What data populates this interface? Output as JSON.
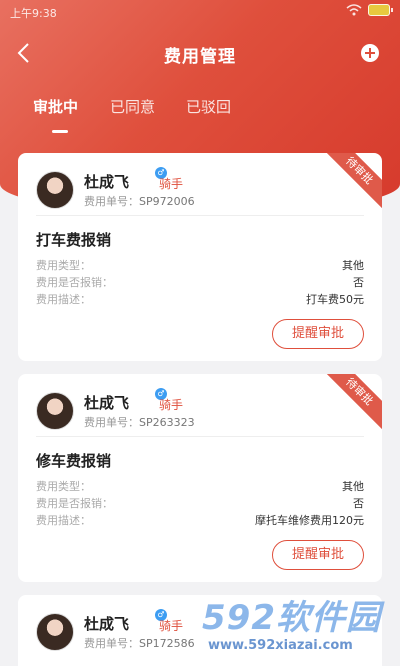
{
  "statusbar": {
    "time": "上午9:38"
  },
  "header": {
    "title": "费用管理"
  },
  "tabs": [
    {
      "label": "审批中",
      "active": true
    },
    {
      "label": "已同意",
      "active": false
    },
    {
      "label": "已驳回",
      "active": false
    }
  ],
  "cards": [
    {
      "status": "待审批",
      "name": "杜成飞",
      "role": "骑手",
      "order_label": "费用单号：",
      "order_no": "SP972006",
      "title": "打车费报销",
      "info": [
        {
          "k": "费用类型：",
          "v": "其他"
        },
        {
          "k": "费用是否报销：",
          "v": "否"
        },
        {
          "k": "费用描述：",
          "v": "打车费50元"
        }
      ],
      "button": "提醒审批"
    },
    {
      "status": "待审批",
      "name": "杜成飞",
      "role": "骑手",
      "order_label": "费用单号：",
      "order_no": "SP263323",
      "title": "修车费报销",
      "info": [
        {
          "k": "费用类型：",
          "v": "其他"
        },
        {
          "k": "费用是否报销：",
          "v": "否"
        },
        {
          "k": "费用描述：",
          "v": "摩托车维修费用120元"
        }
      ],
      "button": "提醒审批"
    },
    {
      "name": "杜成飞",
      "role": "骑手",
      "order_label": "费用单号：",
      "order_no": "SP172586"
    }
  ],
  "watermark": {
    "big": "592软件园",
    "url": "www.592xiazai.com"
  },
  "colors": {
    "accent": "#df4f3c",
    "gender": "#3d9df2"
  }
}
